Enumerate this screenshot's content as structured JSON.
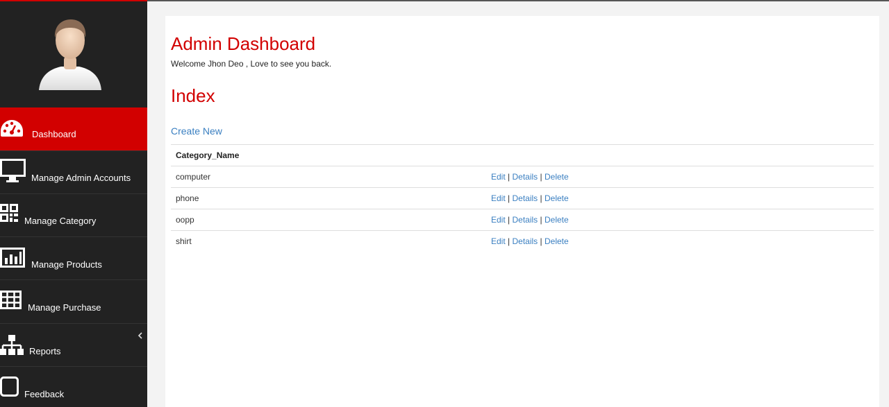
{
  "sidebar": {
    "items": [
      {
        "label": "Dashboard",
        "icon": "dashboard-icon",
        "active": true
      },
      {
        "label": "Manage Admin Accounts",
        "icon": "monitor-icon"
      },
      {
        "label": "Manage Category",
        "icon": "qrcode-icon"
      },
      {
        "label": "Manage Products",
        "icon": "bar-chart-icon"
      },
      {
        "label": "Manage Purchase",
        "icon": "table-icon"
      },
      {
        "label": "Reports",
        "icon": "sitemap-icon"
      },
      {
        "label": "Feedback",
        "icon": "square-icon"
      }
    ]
  },
  "main": {
    "title": "Admin Dashboard",
    "welcome": "Welcome Jhon Deo , Love to see you back.",
    "section_title": "Index",
    "create_link": "Create New",
    "table": {
      "header": "Category_Name",
      "rows": [
        {
          "name": "computer"
        },
        {
          "name": "phone"
        },
        {
          "name": "oopp"
        },
        {
          "name": "shirt"
        }
      ],
      "actions": {
        "edit": "Edit",
        "details": "Details",
        "delete": "Delete",
        "separator": "|"
      }
    }
  },
  "colors": {
    "accent": "#d20000",
    "sidebar": "#222222",
    "link": "#3a7fc1"
  }
}
